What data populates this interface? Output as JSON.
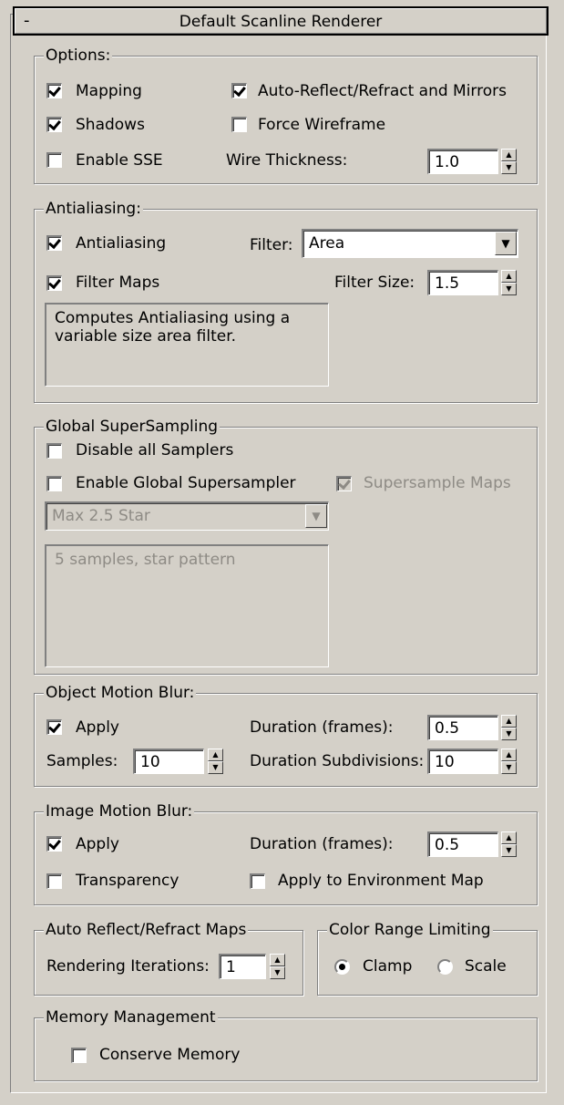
{
  "rollout": {
    "toggle": "-",
    "title": "Default Scanline Renderer"
  },
  "options": {
    "legend": "Options:",
    "mapping": {
      "label": "Mapping",
      "checked": true
    },
    "auto_reflect": {
      "label": "Auto-Reflect/Refract and Mirrors",
      "checked": true
    },
    "shadows": {
      "label": "Shadows",
      "checked": true
    },
    "force_wireframe": {
      "label": "Force Wireframe",
      "checked": false
    },
    "enable_sse": {
      "label": "Enable SSE",
      "checked": false
    },
    "wire_thickness": {
      "label": "Wire Thickness:",
      "value": "1.0"
    }
  },
  "antialiasing": {
    "legend": "Antialiasing:",
    "antialiasing": {
      "label": "Antialiasing",
      "checked": true
    },
    "filter_label": "Filter:",
    "filter_value": "Area",
    "filter_maps": {
      "label": "Filter Maps",
      "checked": true
    },
    "filter_size": {
      "label": "Filter Size:",
      "value": "1.5"
    },
    "description": "Computes Antialiasing using a variable size area filter."
  },
  "supersampling": {
    "legend": "Global SuperSampling",
    "disable_all": {
      "label": "Disable all Samplers",
      "checked": false
    },
    "enable_global": {
      "label": "Enable Global Supersampler",
      "checked": false
    },
    "supersample_maps": {
      "label": "Supersample Maps",
      "checked": true
    },
    "sampler_value": "Max 2.5 Star",
    "description": "5 samples, star pattern"
  },
  "object_motion_blur": {
    "legend": "Object Motion Blur:",
    "apply": {
      "label": "Apply",
      "checked": true
    },
    "duration": {
      "label": "Duration (frames):",
      "value": "0.5"
    },
    "samples": {
      "label": "Samples:",
      "value": "10"
    },
    "subdivisions": {
      "label": "Duration Subdivisions:",
      "value": "10"
    }
  },
  "image_motion_blur": {
    "legend": "Image Motion Blur:",
    "apply": {
      "label": "Apply",
      "checked": true
    },
    "duration": {
      "label": "Duration (frames):",
      "value": "0.5"
    },
    "transparency": {
      "label": "Transparency",
      "checked": false
    },
    "apply_env": {
      "label": "Apply to Environment Map",
      "checked": false
    }
  },
  "auto_reflect_maps": {
    "legend": "Auto Reflect/Refract Maps",
    "iterations": {
      "label": "Rendering Iterations:",
      "value": "1"
    }
  },
  "color_range": {
    "legend": "Color Range Limiting",
    "clamp": {
      "label": "Clamp",
      "selected": true
    },
    "scale": {
      "label": "Scale",
      "selected": false
    }
  },
  "memory": {
    "legend": "Memory Management",
    "conserve": {
      "label": "Conserve Memory",
      "checked": false
    }
  },
  "icons": {
    "spinner_up": "▲",
    "spinner_down": "▼",
    "combo_arrow": "▼"
  }
}
